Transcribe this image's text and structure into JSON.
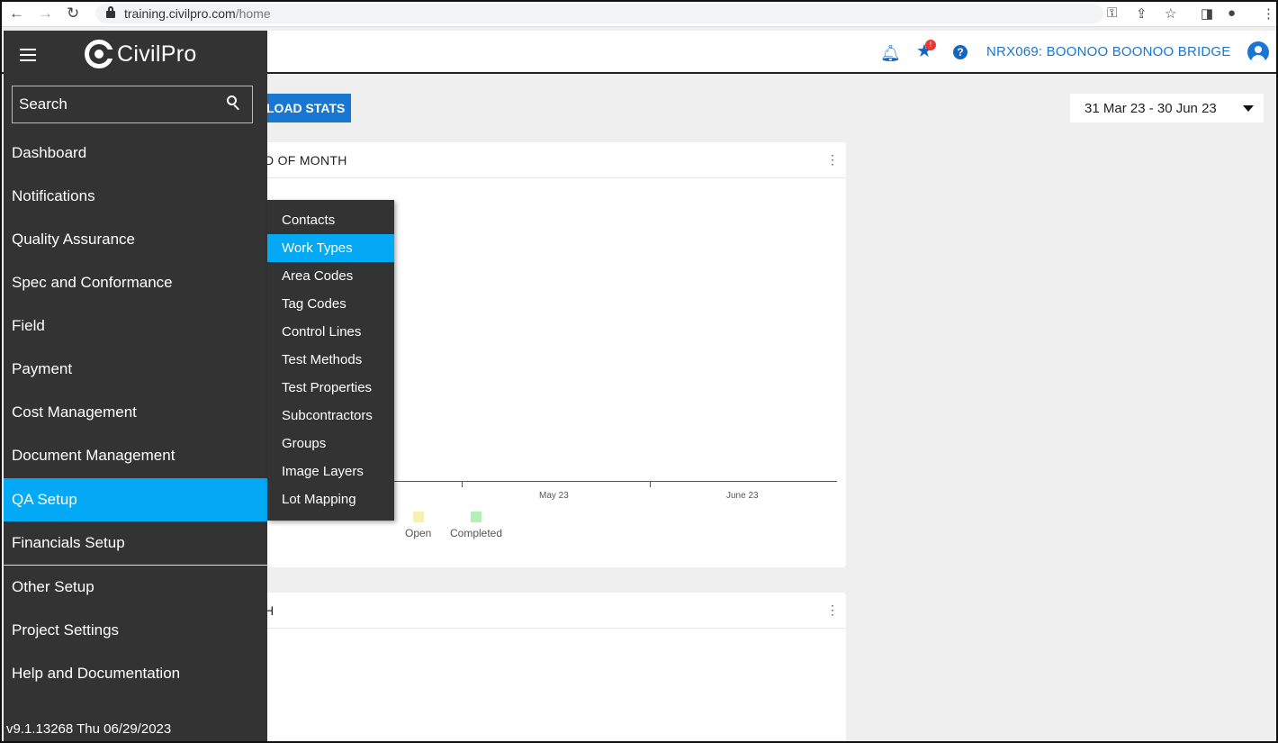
{
  "browser": {
    "url_host": "training.civilpro.com",
    "url_path": "/home"
  },
  "header": {
    "project": "NRX069: BOONOO BOONOO BRIDGE",
    "star_badge": "!"
  },
  "sidebar": {
    "logo": "CivilPro",
    "search_placeholder": "Search",
    "items": [
      {
        "label": "Dashboard",
        "active": false
      },
      {
        "label": "Notifications",
        "active": false
      },
      {
        "label": "Quality Assurance",
        "active": false
      },
      {
        "label": "Spec and Conformance",
        "active": false
      },
      {
        "label": "Field",
        "active": false
      },
      {
        "label": "Payment",
        "active": false
      },
      {
        "label": "Cost Management",
        "active": false
      },
      {
        "label": "Document Management",
        "active": false
      },
      {
        "label": "QA Setup",
        "active": true
      },
      {
        "label": "Financials Setup",
        "active": false
      },
      {
        "label": "Other Setup",
        "active": false
      },
      {
        "label": "Project Settings",
        "active": false
      },
      {
        "label": "Help and Documentation",
        "active": false
      }
    ],
    "version": "v9.1.13268 Thu 06/29/2023"
  },
  "submenu": {
    "items": [
      {
        "label": "Contacts",
        "active": false
      },
      {
        "label": "Work Types",
        "active": true
      },
      {
        "label": "Area Codes",
        "active": false
      },
      {
        "label": "Tag Codes",
        "active": false
      },
      {
        "label": "Control Lines",
        "active": false
      },
      {
        "label": "Test Methods",
        "active": false
      },
      {
        "label": "Test Properties",
        "active": false
      },
      {
        "label": "Subcontractors",
        "active": false
      },
      {
        "label": "Groups",
        "active": false
      },
      {
        "label": "Image Layers",
        "active": false
      },
      {
        "label": "Lot Mapping",
        "active": false
      }
    ]
  },
  "main": {
    "load_stats_label": "LOAD STATS",
    "date_range": "31 Mar 23 - 30 Jun 23",
    "card1_title": "D OF MONTH",
    "card2_title": "H",
    "card_menu_icon": "⋮"
  },
  "chart_data": {
    "type": "bar",
    "categories": [
      "",
      "May 23",
      "June 23"
    ],
    "series": [
      {
        "name": "Open",
        "values": [],
        "color": "#f7f0b0"
      },
      {
        "name": "Completed",
        "values": [],
        "color": "#b4f0b4"
      }
    ]
  },
  "colors": {
    "sidebar_bg": "#333333",
    "accent": "#03a9f4",
    "primary": "#1976d2"
  }
}
